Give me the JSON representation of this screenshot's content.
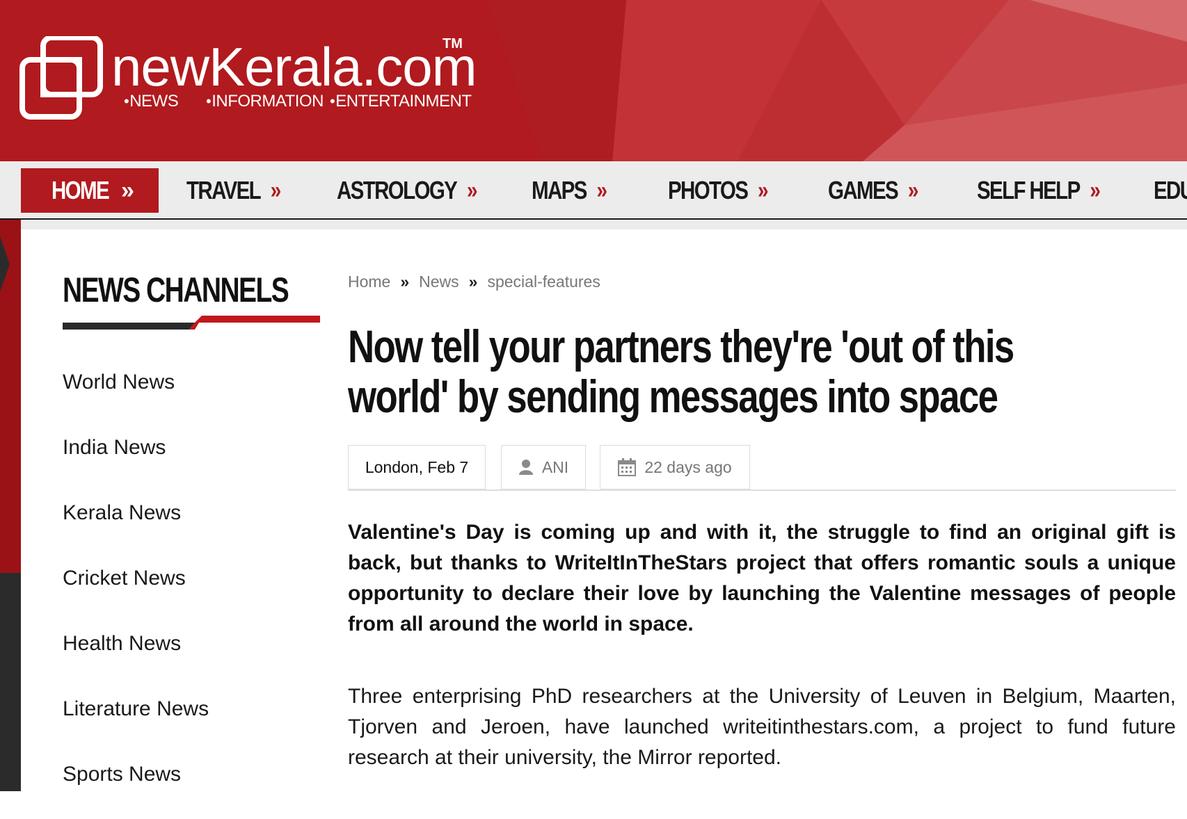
{
  "site": {
    "name": "newKerala.com",
    "trademark": "TM",
    "tags": [
      "NEWS",
      "INFORMATION",
      "ENTERTAINMENT"
    ]
  },
  "nav": {
    "items": [
      {
        "label": "HOME",
        "chevron": "»"
      },
      {
        "label": "TRAVEL",
        "chevron": "»"
      },
      {
        "label": "ASTROLOGY",
        "chevron": "»"
      },
      {
        "label": "MAPS",
        "chevron": "»"
      },
      {
        "label": "PHOTOS",
        "chevron": "»"
      },
      {
        "label": "GAMES",
        "chevron": "»"
      },
      {
        "label": "SELF HELP",
        "chevron": "»"
      },
      {
        "label": "EDU",
        "chevron": ""
      }
    ],
    "active": "HOME"
  },
  "sidebar": {
    "title": "NEWS CHANNELS",
    "items": [
      {
        "label": "World News"
      },
      {
        "label": "India News"
      },
      {
        "label": "Kerala News"
      },
      {
        "label": "Cricket News"
      },
      {
        "label": "Health News"
      },
      {
        "label": "Literature News"
      },
      {
        "label": "Sports News"
      }
    ]
  },
  "breadcrumb": {
    "items": [
      "Home",
      "News",
      "special-features"
    ],
    "separator": "»"
  },
  "article": {
    "headline": "Now tell your partners they're 'out of this world' by sending messages into space",
    "dateline": "London, Feb 7",
    "author": "ANI",
    "age": "22 days ago",
    "lead": "Valentine's Day is coming up and with it, the struggle to find an original gift is back, but thanks to WriteItInTheStars project that offers romantic souls a unique opportunity to declare their love by launching the Valentine messages of people from all around the world in space.",
    "body": "Three enterprising PhD researchers at the University of Leuven in Belgium, Maarten, Tjorven and Jeroen, have launched writeitinthestars.com, a project to fund future research at their university, the Mirror reported."
  },
  "icons": {
    "logo": "logo-squares-icon",
    "author": "user-icon",
    "age": "calendar-icon"
  },
  "colors": {
    "brand_red": "#b11a1e",
    "nav_bg": "#ececec",
    "text_dark": "#111111",
    "muted": "#777777"
  }
}
